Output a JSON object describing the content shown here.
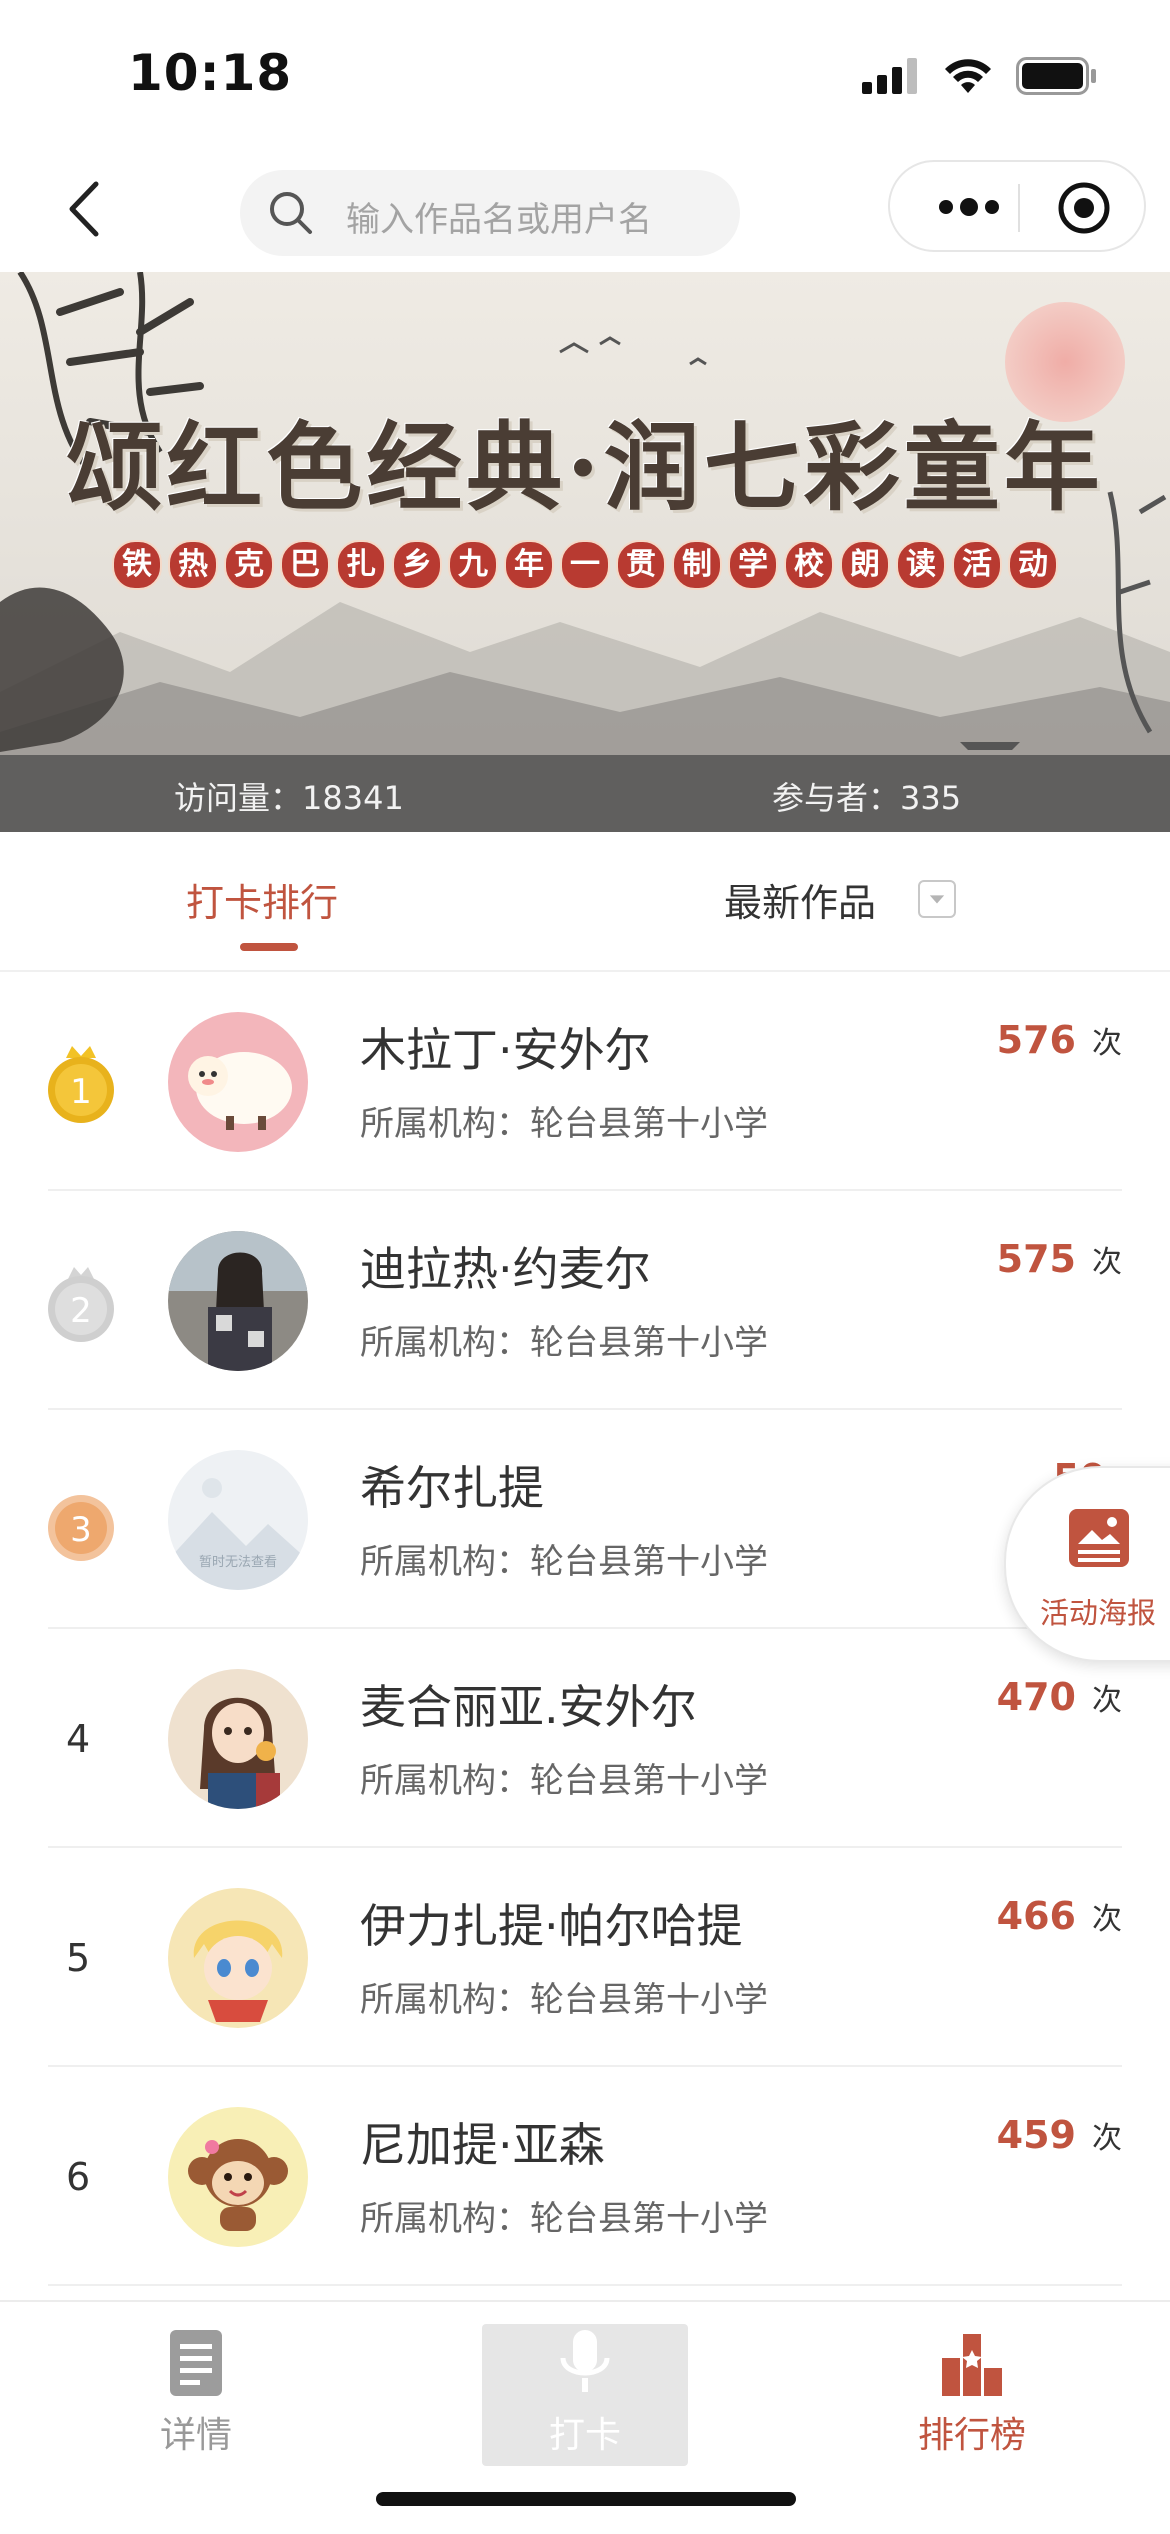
{
  "status": {
    "time": "10:18"
  },
  "search": {
    "placeholder": "输入作品名或用户名"
  },
  "banner": {
    "title": "颂红色经典·润七彩童年",
    "subtitle_chars": [
      "铁",
      "热",
      "克",
      "巴",
      "扎",
      "乡",
      "九",
      "年",
      "一",
      "贯",
      "制",
      "学",
      "校",
      "朗",
      "读",
      "活",
      "动"
    ],
    "visits_label": "访问量：18341",
    "participants_label": "参与者：335"
  },
  "tabs": {
    "rank": "打卡排行",
    "latest": "最新作品"
  },
  "rankings": [
    {
      "rank": "1",
      "name": "木拉丁·安外尔",
      "org": "所属机构：轮台县第十小学",
      "count": "576",
      "unit": "次"
    },
    {
      "rank": "2",
      "name": "迪拉热·约麦尔",
      "org": "所属机构：轮台县第十小学",
      "count": "575",
      "unit": "次"
    },
    {
      "rank": "3",
      "name": "希尔扎提",
      "org": "所属机构：轮台县第十小学",
      "count": "50",
      "unit": ""
    },
    {
      "rank": "4",
      "name": "麦合丽亚.安外尔",
      "org": "所属机构：轮台县第十小学",
      "count": "470",
      "unit": "次"
    },
    {
      "rank": "5",
      "name": "伊力扎提·帕尔哈提",
      "org": "所属机构：轮台县第十小学",
      "count": "466",
      "unit": "次"
    },
    {
      "rank": "6",
      "name": "尼加提·亚森",
      "org": "所属机构：轮台县第十小学",
      "count": "459",
      "unit": "次"
    }
  ],
  "avatar3_text": "暂时无法查看",
  "poster": {
    "label": "活动海报"
  },
  "tabbar": {
    "detail": "详情",
    "checkin": "打卡",
    "ranking": "排行榜"
  },
  "colors": {
    "accent": "#c0543f",
    "gold": "#e8b21c",
    "silver": "#c9c9c9",
    "bronze": "#eea86e"
  }
}
